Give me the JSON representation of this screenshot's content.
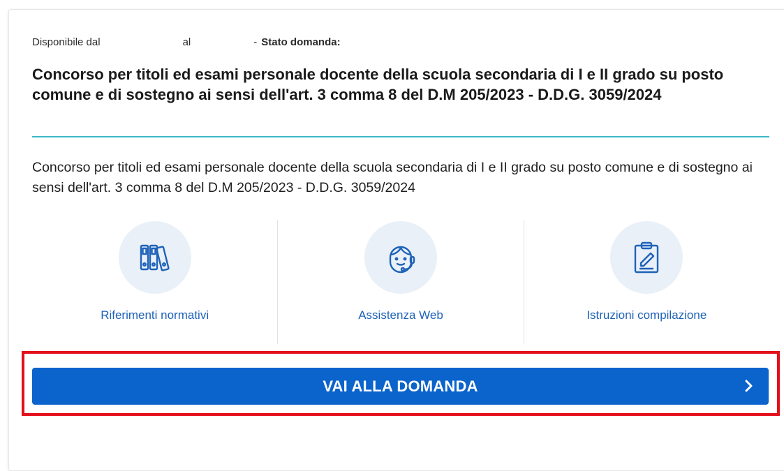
{
  "card": {
    "meta": {
      "available_label": "Disponibile dal",
      "to_label": "al",
      "separator": "-",
      "status_label": "Stato domanda:"
    },
    "title": "Concorso per titoli ed esami personale docente della scuola secondaria di I e II grado su posto comune e di sostegno ai sensi dell'art. 3 comma 8 del D.M 205/2023 - D.D.G. 3059/2024",
    "description": "Concorso per titoli ed esami personale docente della scuola secondaria di I e II grado su posto comune e di sostegno ai sensi dell'art. 3 comma 8 del D.M 205/2023 - D.D.G. 3059/2024",
    "links": [
      {
        "label": "Riferimenti normativi",
        "icon": "binders-icon"
      },
      {
        "label": "Assistenza Web",
        "icon": "headset-support-icon"
      },
      {
        "label": "Istruzioni compilazione",
        "icon": "clipboard-edit-icon"
      }
    ],
    "cta": {
      "label": "VAI ALLA DOMANDA",
      "icon": "chevron-right-icon"
    }
  },
  "colors": {
    "accent": "#0b63cc",
    "link": "#1e62b8",
    "divider": "#3bb9c6",
    "icon_bg": "#e9f0f8",
    "highlight_frame": "#e3101c"
  }
}
